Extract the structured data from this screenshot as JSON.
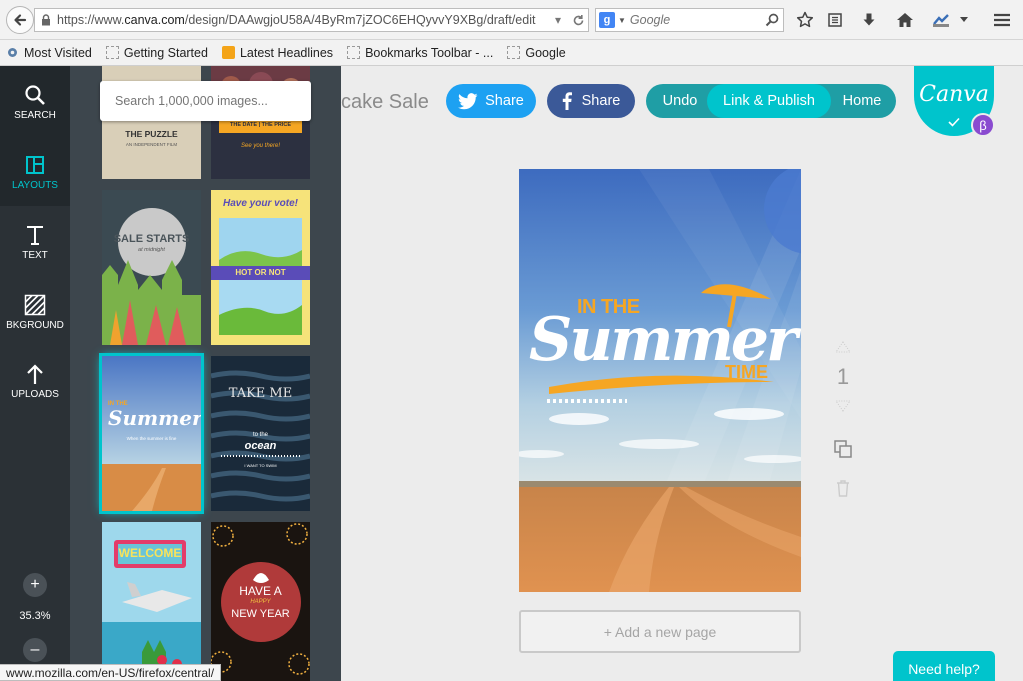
{
  "browser": {
    "url_prefix": "https://www.",
    "url_domain": "canva.com",
    "url_path": "/design/DAAwgjoU58A/4ByRm7jZOC6EHQyvvY9XBg/draft/edit",
    "search_placeholder": "Google",
    "bookmarks": [
      {
        "label": "Most Visited",
        "icon": "gear"
      },
      {
        "label": "Getting Started",
        "icon": "page"
      },
      {
        "label": "Latest Headlines",
        "icon": "rss"
      },
      {
        "label": "Bookmarks Toolbar - ...",
        "icon": "page"
      },
      {
        "label": "Google",
        "icon": "page"
      }
    ],
    "status_url": "www.mozilla.com/en-US/firefox/central/"
  },
  "sidebar": {
    "items": [
      {
        "label": "SEARCH",
        "icon": "search-icon"
      },
      {
        "label": "LAYOUTS",
        "icon": "layouts-icon"
      },
      {
        "label": "TEXT",
        "icon": "text-icon"
      },
      {
        "label": "BKGROUND",
        "icon": "background-icon"
      },
      {
        "label": "UPLOADS",
        "icon": "upload-icon"
      }
    ],
    "zoom_plus": "+",
    "zoom_level": "35.3%",
    "zoom_minus": "–"
  },
  "panel": {
    "search_placeholder": "Search 1,000,000 images...",
    "thumbs": {
      "puzzle_title": "THE PUZZLE",
      "puzzle_sub": "AN INDEPENDENT FILM",
      "date_text": "THE DATE | THE PRICE",
      "date_sub": "See you there!",
      "sale_title": "SALE STARTS",
      "sale_sub": "at midnight",
      "vote_title": "Have your vote!",
      "hot_not": "HOT OR NOT",
      "summer_small_1": "IN THE",
      "summer_small_2": "Summer",
      "summer_small_3": "When the summer is fine",
      "ocean_1": "TAKE ME",
      "ocean_2": "to the",
      "ocean_3": "ocean",
      "ocean_4": "I WANT TO SWIM",
      "welcome": "WELCOME",
      "newyear_1": "HAVE A",
      "newyear_2": "HAPPY",
      "newyear_3": "NEW YEAR"
    }
  },
  "editor": {
    "doc_title": "cake Sale",
    "twitter_share": "Share",
    "facebook_share": "Share",
    "undo": "Undo",
    "link_publish": "Link & Publish",
    "home": "Home",
    "logo": "Canva",
    "beta": "β",
    "design": {
      "line1": "IN THE",
      "line2": "Summer",
      "line3": "TIME"
    },
    "page_number": "1",
    "add_page": "+ Add a new page",
    "need_help": "Need help?"
  },
  "colors": {
    "canva_teal": "#00c4cc",
    "twitter_blue": "#1da1f2",
    "facebook_blue": "#3b5998",
    "sidebar_dark": "#2b3136",
    "panel_gray": "#3d464d",
    "summer_orange": "#f6a623"
  }
}
